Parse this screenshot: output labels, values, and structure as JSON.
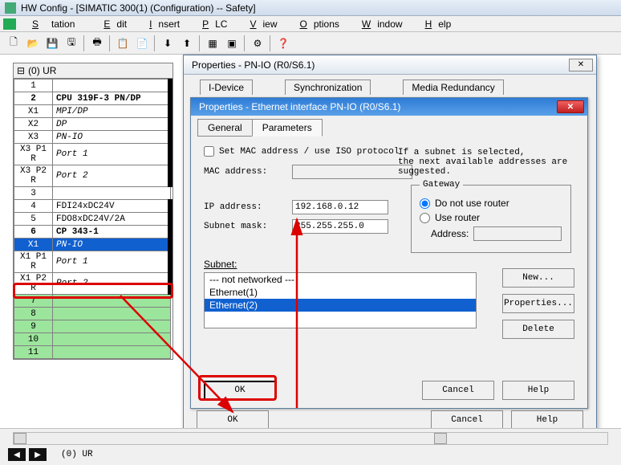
{
  "app_title": "HW Config - [SIMATIC 300(1) (Configuration) -- Safety]",
  "menu": {
    "station": "Station",
    "edit": "Edit",
    "insert": "Insert",
    "plc": "PLC",
    "view": "View",
    "options": "Options",
    "window": "Window",
    "help": "Help"
  },
  "rack": {
    "title": "(0) UR",
    "rows": [
      {
        "slot": "1",
        "mod": "",
        "cls": "",
        "thick": true
      },
      {
        "slot": "2",
        "mod": "CPU 319F-3 PN/DP",
        "cls": "bold",
        "thick": true
      },
      {
        "slot": "X1",
        "mod": "MPI/DP",
        "cls": "italic",
        "thick": true
      },
      {
        "slot": "X2",
        "mod": "DP",
        "cls": "italic",
        "thick": true
      },
      {
        "slot": "X3",
        "mod": "PN-IO",
        "cls": "italic",
        "thick": true
      },
      {
        "slot": "X3 P1 R",
        "mod": "Port 1",
        "cls": "italic",
        "thick": true
      },
      {
        "slot": "X3 P2 R",
        "mod": "Port 2",
        "cls": "italic",
        "thick": true
      },
      {
        "slot": "3",
        "mod": "",
        "cls": "",
        "thick": false
      },
      {
        "slot": "4",
        "mod": "FDI24xDC24V",
        "cls": "",
        "thick": true
      },
      {
        "slot": "5",
        "mod": "FDO8xDC24V/2A",
        "cls": "",
        "thick": true
      },
      {
        "slot": "6",
        "mod": "CP 343-1",
        "cls": "bold",
        "thick": true
      },
      {
        "slot": "X1",
        "mod": "PN-IO",
        "cls": "sel italic",
        "thick": true
      },
      {
        "slot": "X1 P1 R",
        "mod": "Port 1",
        "cls": "italic",
        "thick": true
      },
      {
        "slot": "X1 P2 R",
        "mod": "Port 2",
        "cls": "italic",
        "thick": true
      },
      {
        "slot": "7",
        "mod": "",
        "cls": "green",
        "thick": false
      },
      {
        "slot": "8",
        "mod": "",
        "cls": "green",
        "thick": false
      },
      {
        "slot": "9",
        "mod": "",
        "cls": "green",
        "thick": false
      },
      {
        "slot": "10",
        "mod": "",
        "cls": "green",
        "thick": false
      },
      {
        "slot": "11",
        "mod": "",
        "cls": "green",
        "thick": false
      }
    ]
  },
  "props": {
    "title": "Properties - PN-IO (R0/S6.1)",
    "tabs": [
      "I-Device",
      "Synchronization",
      "Media Redundancy"
    ]
  },
  "inner": {
    "title": "Properties - Ethernet interface  PN-IO (R0/S6.1)",
    "tabs": {
      "general": "General",
      "parameters": "Parameters"
    },
    "set_mac": "Set MAC address / use ISO protocol",
    "mac_label": "MAC address:",
    "mac_value": "",
    "hint": "If a subnet is selected,\nthe next available addresses are\nsuggested.",
    "ip_label": "IP address:",
    "ip_value": "192.168.0.12",
    "mask_label": "Subnet mask:",
    "mask_value": "255.255.255.0",
    "gateway": {
      "legend": "Gateway",
      "no_router": "Do not use router",
      "use_router": "Use router",
      "addr_label": "Address:",
      "addr_value": ""
    },
    "subnet_label": "Subnet:",
    "subnets": [
      "--- not networked ---",
      "Ethernet(1)",
      "Ethernet(2)"
    ],
    "subnet_selected": 2,
    "btn_new": "New...",
    "btn_props": "Properties...",
    "btn_delete": "Delete"
  },
  "buttons": {
    "ok": "OK",
    "cancel": "Cancel",
    "help": "Help"
  },
  "status": {
    "nav": "(0)  UR"
  }
}
